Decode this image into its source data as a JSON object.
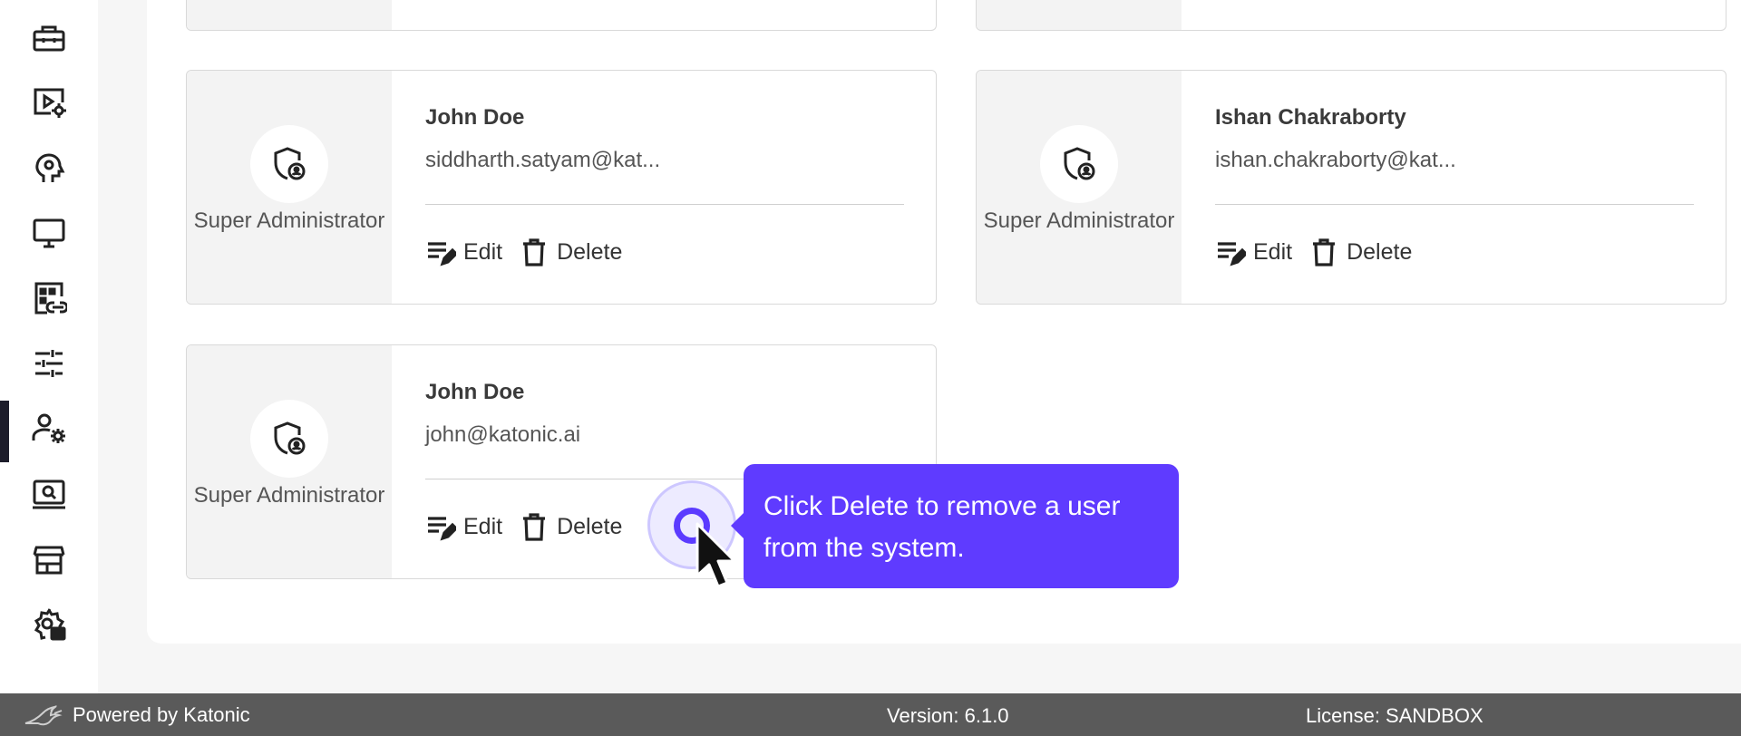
{
  "sidebar": {
    "items": [
      {
        "icon": "toolbox-icon"
      },
      {
        "icon": "video-settings-icon"
      },
      {
        "icon": "psychology-icon"
      },
      {
        "icon": "monitor-icon"
      },
      {
        "icon": "app-link-icon"
      },
      {
        "icon": "tune-icon"
      },
      {
        "icon": "manage-accounts-icon",
        "active": true
      },
      {
        "icon": "screen-search-icon"
      },
      {
        "icon": "storefront-icon"
      },
      {
        "icon": "admin-settings-icon"
      }
    ]
  },
  "users": [
    {
      "name": "John Doe",
      "email": "siddharth.satyam@kat...",
      "role": "Super Administrator"
    },
    {
      "name": "Ishan Chakraborty",
      "email": "ishan.chakraborty@kat...",
      "role": "Super Administrator"
    },
    {
      "name": "John Doe",
      "email": "john@katonic.ai",
      "role": "Super Administrator"
    }
  ],
  "actions": {
    "edit_label": "Edit",
    "delete_label": "Delete"
  },
  "tooltip": {
    "text": "Click Delete to remove a user from the system."
  },
  "footer": {
    "powered_by": "Powered by Katonic",
    "version": "Version: 6.1.0",
    "license": "License: SANDBOX"
  },
  "colors": {
    "accent": "#5f3bff",
    "sidebar_active": "#1d1d2b",
    "footer_bg": "#5a5a5a"
  }
}
